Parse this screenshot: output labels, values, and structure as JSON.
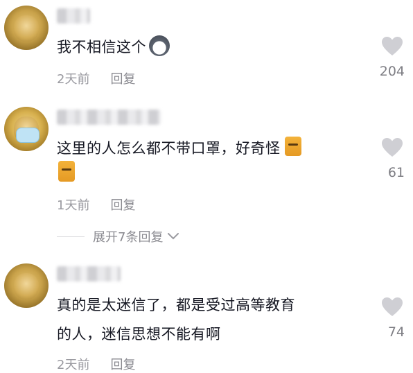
{
  "comments": [
    {
      "text": "我不相信这个",
      "emoji": "husky-face-emoji",
      "time": "2天前",
      "reply_label": "回复",
      "likes": "204"
    },
    {
      "text": "这里的人怎么都不带口罩，好奇怪",
      "emoji": "cat-face-emoji",
      "time": "1天前",
      "reply_label": "回复",
      "likes": "61"
    },
    {
      "text_line1": "真的是太迷信了，都是受过高等教育",
      "text_line2": "的人，迷信思想不能有啊",
      "time": "2天前",
      "reply_label": "回复",
      "likes": "74"
    }
  ],
  "expand_replies": "展开7条回复",
  "icons": {
    "like": "heart-icon",
    "expand": "chevron-down-icon"
  },
  "colors": {
    "text": "#161823",
    "meta": "#9a9aa0",
    "heart": "#cfcfd4"
  }
}
